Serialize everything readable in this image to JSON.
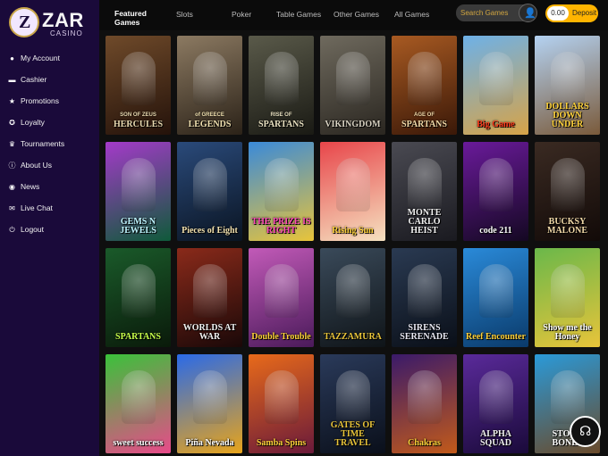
{
  "brand": {
    "name": "ZAR",
    "sub": "CASINO",
    "mark": "Z"
  },
  "sidebar": {
    "items": [
      {
        "label": "My Account",
        "icon": "user-icon",
        "glyph": "●"
      },
      {
        "label": "Cashier",
        "icon": "wallet-icon",
        "glyph": "▬"
      },
      {
        "label": "Promotions",
        "icon": "star-icon",
        "glyph": "★"
      },
      {
        "label": "Loyalty",
        "icon": "medal-icon",
        "glyph": "✪"
      },
      {
        "label": "Tournaments",
        "icon": "trophy-icon",
        "glyph": "♛"
      },
      {
        "label": "About Us",
        "icon": "info-icon",
        "glyph": "ⓘ"
      },
      {
        "label": "News",
        "icon": "news-icon",
        "glyph": "◉"
      },
      {
        "label": "Live Chat",
        "icon": "chat-icon",
        "glyph": "✉"
      },
      {
        "label": "Logout",
        "icon": "logout-icon",
        "glyph": "⏻"
      }
    ]
  },
  "topbar": {
    "tabs": [
      {
        "label": "Featured",
        "label2": "Games",
        "active": true
      },
      {
        "label": "Slots"
      },
      {
        "label": "Poker"
      },
      {
        "label": "Table Games"
      },
      {
        "label": "Other Games"
      },
      {
        "label": "All Games"
      }
    ],
    "search_placeholder": "Search Games",
    "balance": "0.00",
    "deposit_label": "Deposit"
  },
  "colors": {
    "accent": "#ffb400",
    "sidebar": "#1a0a3a"
  },
  "games": [
    {
      "title": "HERCULES",
      "sub": "SON OF ZEUS",
      "c1": "#6f4a2a",
      "c2": "#24120a",
      "tc": "#e8d9b0"
    },
    {
      "title": "LEGENDS",
      "sub": "of GREECE",
      "c1": "#8c7a62",
      "c2": "#2b2218",
      "tc": "#f1e1b0"
    },
    {
      "title": "SPARTANS",
      "sub": "RISE OF",
      "c1": "#5a5a4a",
      "c2": "#1a1a14",
      "tc": "#e8e0c0"
    },
    {
      "title": "VIKINGDOM",
      "sub": "",
      "c1": "#6f6a5e",
      "c2": "#2a2620",
      "tc": "#d8d2c2"
    },
    {
      "title": "SPARTANS",
      "sub": "AGE OF",
      "c1": "#a85a22",
      "c2": "#3a1808",
      "tc": "#f1d9a8"
    },
    {
      "title": "Big Game",
      "sub": "",
      "c1": "#6db1e8",
      "c2": "#d7a347",
      "tc": "#ff3a1a"
    },
    {
      "title": "DOLLARS DOWN UNDER",
      "sub": "",
      "c1": "#b4d2f2",
      "c2": "#7a5a3a",
      "tc": "#ffd23a"
    },
    {
      "title": "GEMS N JEWELS",
      "sub": "",
      "c1": "#a43ac9",
      "c2": "#0f5a3a",
      "tc": "#bff5ff"
    },
    {
      "title": "Pieces of Eight",
      "sub": "",
      "c1": "#2a4a7a",
      "c2": "#0a1422",
      "tc": "#f1e1b0"
    },
    {
      "title": "THE PRIZE IS RIGHT",
      "sub": "",
      "c1": "#3a8ad9",
      "c2": "#e8c43a",
      "tc": "#ff4ab8"
    },
    {
      "title": "Rising Sun",
      "sub": "",
      "c1": "#e8454a",
      "c2": "#f5e1c0",
      "tc": "#ffd23a"
    },
    {
      "title": "MONTE CARLO HEIST",
      "sub": "",
      "c1": "#4a4a52",
      "c2": "#1a1a20",
      "tc": "#f2f2f2"
    },
    {
      "title": "code 211",
      "sub": "",
      "c1": "#6a1a9a",
      "c2": "#140822",
      "tc": "#ffffff"
    },
    {
      "title": "BUCKSY MALONE",
      "sub": "",
      "c1": "#3a2a22",
      "c2": "#120a08",
      "tc": "#f1d9a8"
    },
    {
      "title": "SPARTANS",
      "sub": "",
      "c1": "#1a5a2a",
      "c2": "#0a1a0a",
      "tc": "#c8ff4a"
    },
    {
      "title": "WORLDS AT WAR",
      "sub": "",
      "c1": "#8a2a1a",
      "c2": "#1a0808",
      "tc": "#f2f2f2"
    },
    {
      "title": "Double Trouble",
      "sub": "",
      "c1": "#c25ab8",
      "c2": "#4a1a5a",
      "tc": "#ffd23a"
    },
    {
      "title": "TAZZAMURA",
      "sub": "",
      "c1": "#3a4a5a",
      "c2": "#0f1418",
      "tc": "#e8c43a"
    },
    {
      "title": "SIRENS SERENADE",
      "sub": "",
      "c1": "#2a3a52",
      "c2": "#0a0f18",
      "tc": "#e8e8f2"
    },
    {
      "title": "Reef Encounter",
      "sub": "",
      "c1": "#2a8ad9",
      "c2": "#0a3a6a",
      "tc": "#ffd23a"
    },
    {
      "title": "Show me the Honey",
      "sub": "",
      "c1": "#6ab84a",
      "c2": "#e8c43a",
      "tc": "#ffffff"
    },
    {
      "title": "sweet success",
      "sub": "",
      "c1": "#3ac23a",
      "c2": "#e84a8a",
      "tc": "#ffffff"
    },
    {
      "title": "Piña Nevada",
      "sub": "",
      "c1": "#2a6ae8",
      "c2": "#e8a41a",
      "tc": "#ffffff"
    },
    {
      "title": "Samba Spins",
      "sub": "",
      "c1": "#e86a1a",
      "c2": "#6a1a3a",
      "tc": "#ffd23a"
    },
    {
      "title": "GATES OF TIME TRAVEL",
      "sub": "",
      "c1": "#2a3a5a",
      "c2": "#0a0f1a",
      "tc": "#e8c43a"
    },
    {
      "title": "Chakras",
      "sub": "",
      "c1": "#3a1a6a",
      "c2": "#c25a1a",
      "tc": "#ffd23a"
    },
    {
      "title": "ALPHA SQUAD",
      "sub": "",
      "c1": "#5a2a9a",
      "c2": "#1a0a3a",
      "tc": "#f2f2f2"
    },
    {
      "title": "STONE BONES",
      "sub": "",
      "c1": "#2a9ad9",
      "c2": "#6a4a2a",
      "tc": "#ffffff"
    }
  ]
}
